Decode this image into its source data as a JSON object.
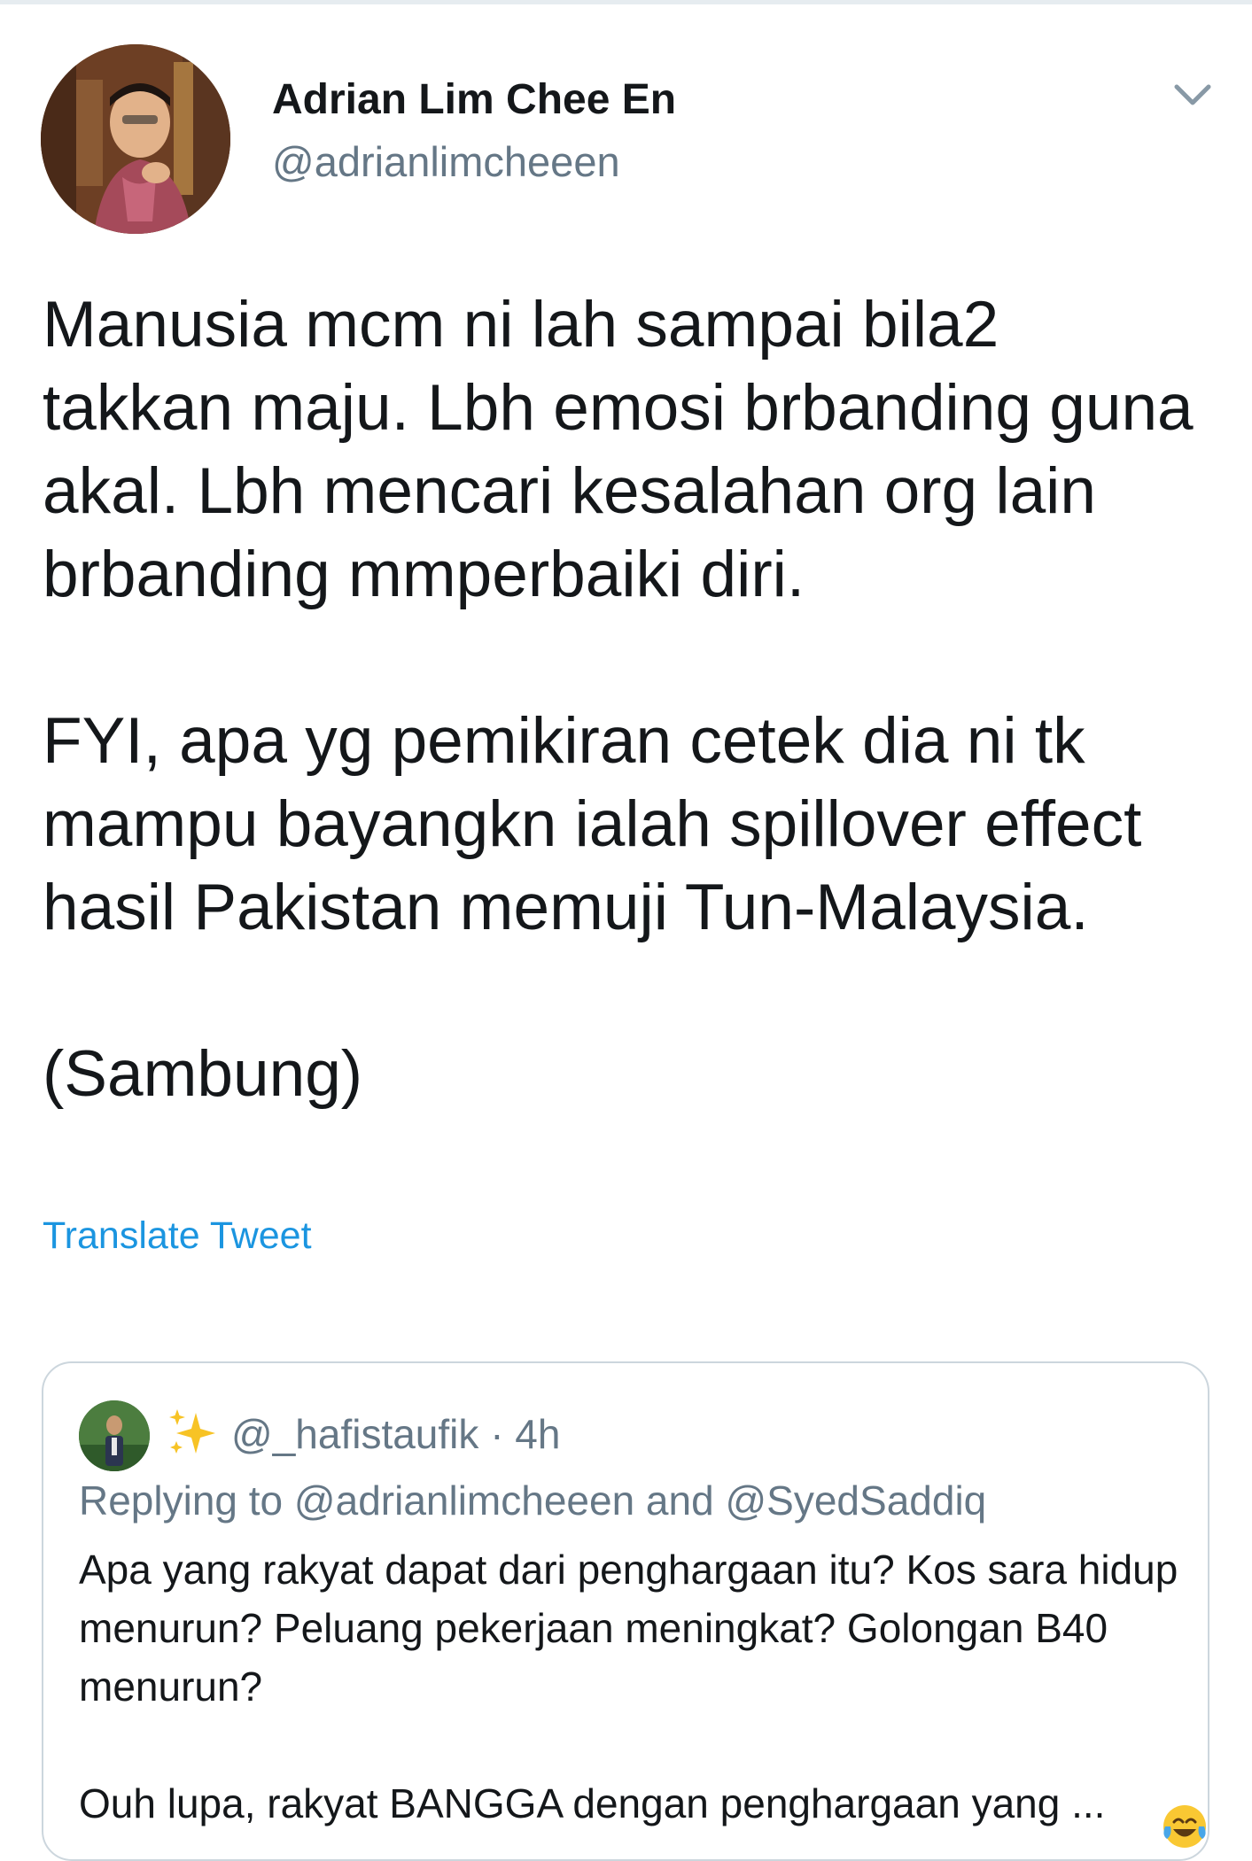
{
  "tweet": {
    "author": {
      "display_name": "Adrian Lim Chee En",
      "handle": "@adrianlimcheeen"
    },
    "paragraphs": [
      "Manusia mcm ni lah sampai bila2\ntakkan maju. Lbh emosi brbanding guna\nakal. Lbh mencari kesalahan org lain\nbrbanding mmperbaiki diri.",
      "FYI, apa yg pemikiran cetek dia ni tk\nmampu bayangkn ialah spillover effect\nhasil Pakistan memuji Tun-Malaysia.",
      "(Sambung)"
    ],
    "translate_label": "Translate Tweet"
  },
  "quoted_tweet": {
    "handle": "@_hafistaufik",
    "time": "· 4h",
    "replying_to": "Replying to @adrianlimcheeen and @SyedSaddiq",
    "paragraphs": [
      "Apa yang rakyat dapat dari penghargaan itu? Kos sara hidup menurun? Peluang pekerjaan meningkat? Golongan B40 menurun?",
      "Ouh lupa, rakyat BANGGA dengan penghargaan yang ..."
    ]
  },
  "icons": {
    "more": "chevron-down-icon",
    "sparkles": "sparkles-icon",
    "laughing": "face-with-tears-of-joy-icon"
  },
  "colors": {
    "link": "#1b95e0",
    "secondary_text": "#657786",
    "border": "#ccd6dd"
  }
}
